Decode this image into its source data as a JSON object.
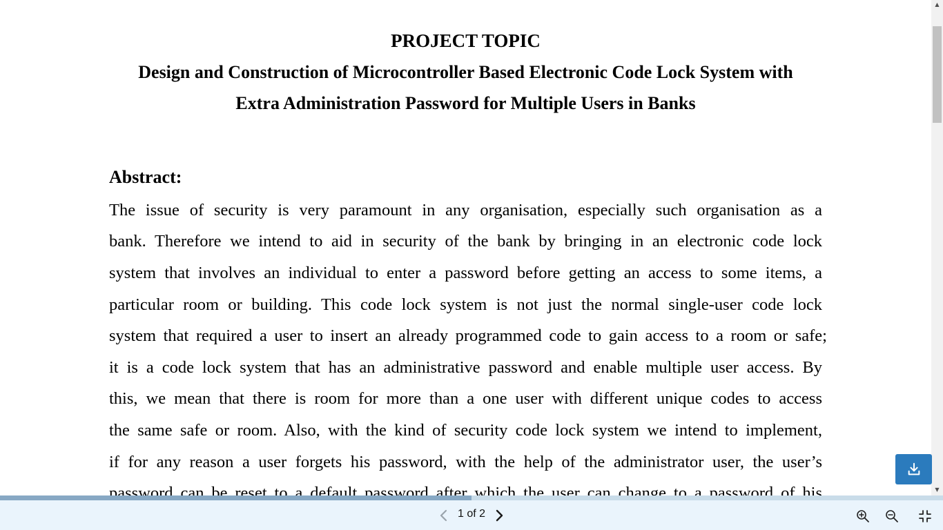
{
  "document": {
    "heading": "PROJECT TOPIC",
    "title_line1": "Design and Construction of Microcontroller Based Electronic Code Lock System with",
    "title_line2": "Extra Administration Password for Multiple Users in Banks",
    "abstract_heading": "Abstract:",
    "abstract_lines": [
      "The issue of security is very paramount in any organisation, especially such organisation as a",
      "bank. Therefore we intend to aid in security of the bank by bringing in an electronic code lock",
      "system that involves an individual to enter a password before getting an access to some items, a",
      "particular room or building. This code lock system is not just the normal single-user code lock",
      "system that required a user to insert an already programmed code to gain access to a room or safe;",
      "it is a code lock system that has an administrative password and enable multiple user access. By",
      "this, we mean that there is room for more than a one user with different unique codes to access",
      "the same safe or room. Also, with the kind of security code lock system we intend to implement,",
      "if for any reason a user forgets his password, with the help of the administrator user, the user’s",
      "password can be reset to a default password after which the user can change to a password of his"
    ]
  },
  "toolbar": {
    "page_label": "1 of 2",
    "prev_icon": "chevron-left-icon",
    "next_icon": "chevron-right-icon",
    "zoom_in_icon": "zoom-in-icon",
    "zoom_out_icon": "zoom-out-icon",
    "fit_icon": "exit-fullscreen-icon"
  },
  "progress_fraction": 0.5,
  "download_icon": "download-icon",
  "colors": {
    "toolbar_bg": "#eaf4fc",
    "accent": "#2b7bbd",
    "progress_track": "#c9dce9",
    "progress_fill": "#87a8c4"
  }
}
